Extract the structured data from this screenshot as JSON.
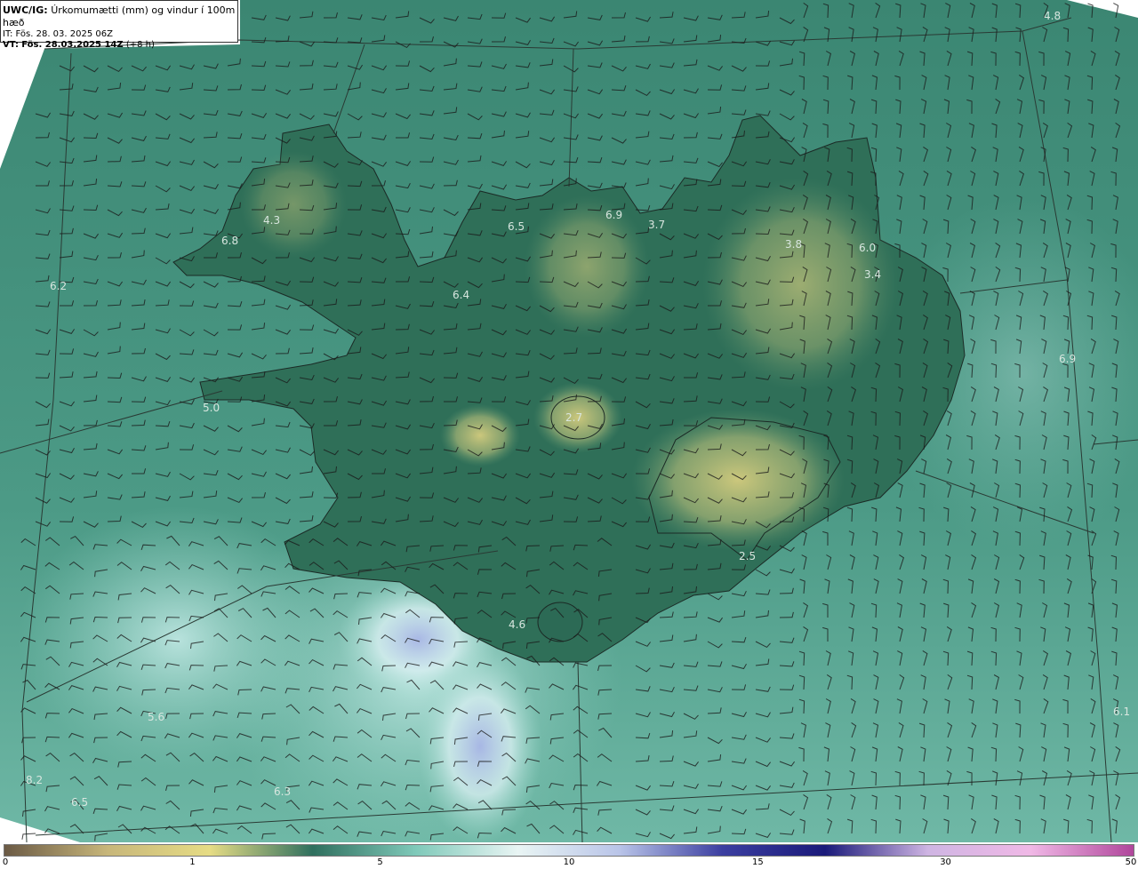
{
  "header": {
    "model": "UWC/IG:",
    "title": "Úrkomumætti (mm) og vindur í 100m hæð",
    "init_label": "IT:",
    "init_time": "Fös. 28. 03. 2025 06Z",
    "valid_label": "VT:",
    "valid_time": "Fös. 28.03.2025 14Z",
    "lead": "(+8 h)"
  },
  "legend": {
    "ticks": [
      "0",
      "1",
      "5",
      "10",
      "15",
      "30",
      "50"
    ],
    "tick_values": [
      0,
      1,
      5,
      10,
      15,
      30,
      50
    ],
    "tick_fractions": [
      0,
      0.167,
      0.333,
      0.5,
      0.667,
      0.833,
      1.0
    ],
    "colors": [
      "#6b5a45",
      "#c7b67a",
      "#e6dc85",
      "#2f6f5e",
      "#7fc9b9",
      "#e9f5f4",
      "#b9c4e8",
      "#3b3ea0",
      "#1a1a7a",
      "#cfb5e3",
      "#f0b8e6",
      "#b0469b"
    ]
  },
  "labels": [
    {
      "text": "4.8"
    },
    {
      "text": "4.3"
    },
    {
      "text": "6.8"
    },
    {
      "text": "6.2"
    },
    {
      "text": "6.5"
    },
    {
      "text": "6.9"
    },
    {
      "text": "3.7"
    },
    {
      "text": "3.8"
    },
    {
      "text": "6.0"
    },
    {
      "text": "3.4"
    },
    {
      "text": "6.4"
    },
    {
      "text": "6.9"
    },
    {
      "text": "5.0"
    },
    {
      "text": "2.7"
    },
    {
      "text": "2.5"
    },
    {
      "text": "4.6"
    },
    {
      "text": "5.6"
    },
    {
      "text": "6.1"
    },
    {
      "text": "8.2"
    },
    {
      "text": "6.5"
    },
    {
      "text": "6.3"
    }
  ],
  "colors": {
    "sea": "#3f8a78",
    "land_low": "#2f6b55",
    "land_high": "#c2c07a",
    "heavy": "#b6c4e6"
  }
}
